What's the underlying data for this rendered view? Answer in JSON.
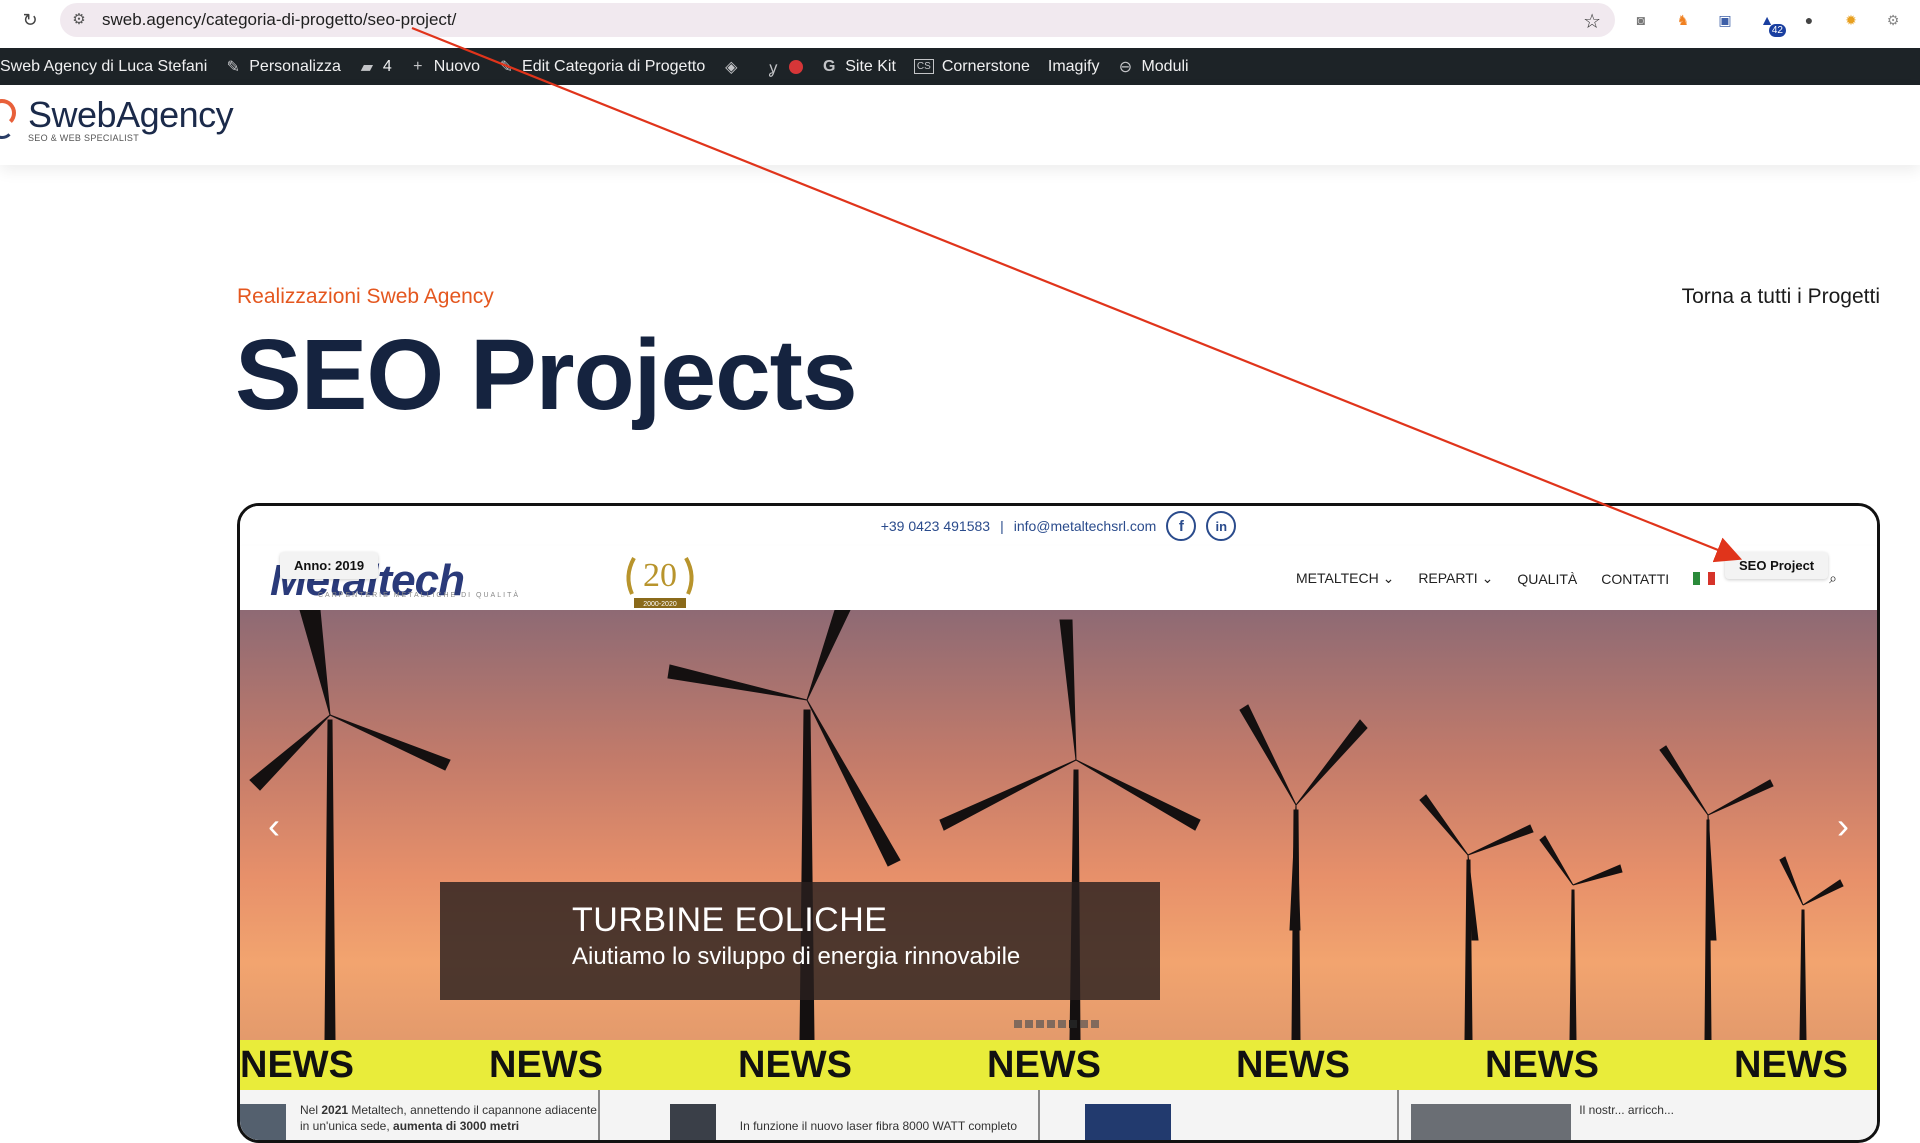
{
  "browser": {
    "url": "sweb.agency/categoria-di-progetto/seo-project/",
    "extension_badge": "42"
  },
  "admin_bar": {
    "site_name": "Sweb Agency di Luca Stefani",
    "customize": "Personalizza",
    "comments_count": "4",
    "new": "Nuovo",
    "edit": "Edit Categoria di Progetto",
    "site_kit": "Site Kit",
    "cornerstone": "Cornerstone",
    "imagify": "Imagify",
    "modules": "Moduli"
  },
  "site": {
    "logo_name_bold": "Sweb",
    "logo_name_rest": "Agency",
    "logo_tagline": "SEO & WEB SPECIALIST"
  },
  "page": {
    "eyebrow": "Realizzazioni Sweb Agency",
    "title": "SEO Projects",
    "back_link": "Torna a tutti i Progetti"
  },
  "card": {
    "year_tag": "Anno: 2019",
    "category_tag": "SEO Project",
    "preview": {
      "phone": "+39 0423 491583",
      "separator": "|",
      "email": "info@metaltechsrl.com",
      "facebook_glyph": "f",
      "linkedin_glyph": "in",
      "logo_text": "Metaltech",
      "logo_subtitle": "CARPENTERIE METALLICHE DI QUALITÀ",
      "anniversary_number": "20",
      "anniversary_years": "2000-2020",
      "menu": [
        "METALTECH",
        "REPARTI",
        "QUALITÀ",
        "CONTATTI"
      ],
      "hero_title": "TURBINE EOLICHE",
      "hero_subtitle": "Aiutiamo lo sviluppo di energia rinnovabile",
      "news_word": "NEWS",
      "news_items": [
        {
          "text_1": "Nel ",
          "bold_1": "2021",
          "text_2": " Metaltech, annettendo il capannone adiacente in un'unica sede, ",
          "bold_2": "aumenta di 3000 metri"
        },
        {
          "text_1": "In funzione il nuovo laser fibra 8000 WATT completo",
          "bold_1": "",
          "text_2": "",
          "bold_2": ""
        },
        {
          "text_1": "",
          "bold_1": "",
          "text_2": "",
          "bold_2": ""
        },
        {
          "text_1": "Il nostr... arricch...",
          "bold_1": "",
          "text_2": "",
          "bold_2": ""
        }
      ]
    }
  },
  "colors": {
    "accent": "#e4571f",
    "title": "#15233f",
    "admin_bar": "#1d2327",
    "news_band": "#e9ec3a",
    "annotation_arrow": "#e0341b"
  }
}
